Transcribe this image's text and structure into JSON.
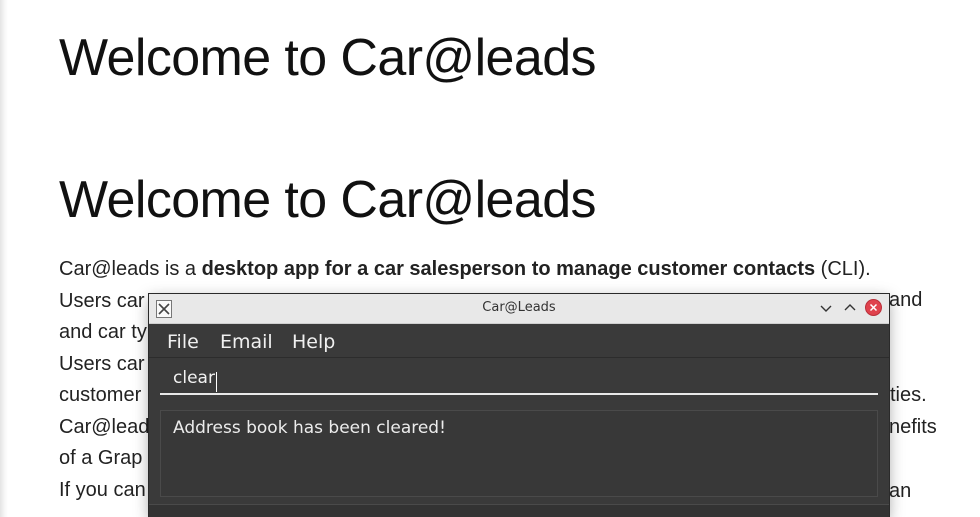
{
  "doc": {
    "heading1": "Welcome to Car@leads",
    "heading2": "Welcome to Car@leads",
    "intro_prefix": "Car@leads is a ",
    "intro_bold": "desktop app for a car salesperson to manage customer contacts",
    "intro_suffix": " (CLI).",
    "line2_start": "Users car",
    "line2_end": "and",
    "line3_start": "and car ty",
    "line4_start": "Users car",
    "line5_start": "customer",
    "line5_end": "ties.",
    "line6_start": "Car@lead",
    "line6_end": "nefits",
    "line7_start": "of a Grap",
    "line8_start": "If you can",
    "line8_end": "an"
  },
  "window": {
    "title": "Car@Leads",
    "icon": "x11-app-icon",
    "controls": {
      "minimize_icon": "chevron-down-icon",
      "maximize_icon": "chevron-up-icon",
      "close_icon": "close-icon",
      "minimize_glyph": "⌄",
      "maximize_glyph": "⌃",
      "close_glyph": "✕"
    }
  },
  "menu": {
    "items": [
      "File",
      "Email",
      "Help"
    ]
  },
  "command": {
    "value": "clear"
  },
  "result": {
    "message": "Address book has been cleared!"
  },
  "colors": {
    "app_background": "#3a3a3a",
    "titlebar": "#e8e8e8",
    "close_button": "#e0424d",
    "text_light": "#f0f0f0"
  }
}
